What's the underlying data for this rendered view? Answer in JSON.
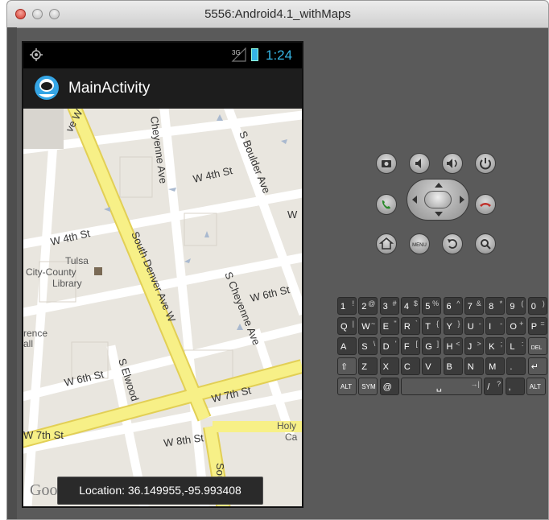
{
  "window": {
    "title": "5556:Android4.1_withMaps"
  },
  "statusbar": {
    "signal": "3G",
    "time": "1:24"
  },
  "actionbar": {
    "title": "MainActivity"
  },
  "map": {
    "streets": {
      "main_vertical": "South Denver Ave W",
      "w4th_top": "W 4th St",
      "w4th_left": "W 4th St",
      "cheyenne_top": "Cheyenne Ave",
      "s_boulder": "S Boulder Ave",
      "s_cheyenne_mid": "S Cheyenne Ave",
      "w6th_right": "W 6th St",
      "w6th_left": "W 6th St",
      "s_elwood": "S Elwood",
      "w7th_right": "W 7th St",
      "w7th_left": "W 7th St",
      "w8th": "W 8th St",
      "south_d": "South D",
      "denver_top": "ve W",
      "w_edge": "W"
    },
    "poi": {
      "library_line1": "Tulsa",
      "library_line2": "City-County",
      "library_line3": "Library",
      "left_poi1": "rence",
      "left_poi2": "all",
      "holy1": "Holy",
      "holy2": "Ca"
    },
    "attribution": "Google"
  },
  "toast": {
    "text": "Location: 36.149955,-95.993408"
  },
  "controls": {
    "row1": [
      "camera-icon",
      "volume-down-icon",
      "volume-up-icon",
      "power-icon"
    ],
    "row2": [
      "call-icon",
      "dpad",
      "end-call-icon"
    ],
    "row3": [
      "home-icon",
      "menu-icon",
      "back-icon",
      "search-icon"
    ],
    "menu_label": "MENU"
  },
  "keyboard": {
    "row1": [
      {
        "k": "1",
        "s": "!"
      },
      {
        "k": "2",
        "s": "@"
      },
      {
        "k": "3",
        "s": "#"
      },
      {
        "k": "4",
        "s": "$"
      },
      {
        "k": "5",
        "s": "%"
      },
      {
        "k": "6",
        "s": "^"
      },
      {
        "k": "7",
        "s": "&"
      },
      {
        "k": "8",
        "s": "*"
      },
      {
        "k": "9",
        "s": "("
      },
      {
        "k": "0",
        "s": ")"
      }
    ],
    "row2": [
      {
        "k": "Q",
        "s": "|"
      },
      {
        "k": "W",
        "s": "~"
      },
      {
        "k": "E",
        "s": "\""
      },
      {
        "k": "R",
        "s": "`"
      },
      {
        "k": "T",
        "s": "{"
      },
      {
        "k": "Y",
        "s": "}"
      },
      {
        "k": "U",
        "s": "-"
      },
      {
        "k": "I",
        "s": "-"
      },
      {
        "k": "O",
        "s": "+"
      },
      {
        "k": "P",
        "s": "="
      }
    ],
    "row3": [
      {
        "k": "A",
        "s": ""
      },
      {
        "k": "S",
        "s": "\\"
      },
      {
        "k": "D",
        "s": "'"
      },
      {
        "k": "F",
        "s": "["
      },
      {
        "k": "G",
        "s": "]"
      },
      {
        "k": "H",
        "s": "<"
      },
      {
        "k": "J",
        "s": ">"
      },
      {
        "k": "K",
        "s": ";"
      },
      {
        "k": "L",
        "s": ":"
      },
      {
        "k": "DEL",
        "s": ""
      }
    ],
    "row4": [
      {
        "k": "⇧",
        "s": ""
      },
      {
        "k": "Z",
        "s": ""
      },
      {
        "k": "X",
        "s": ""
      },
      {
        "k": "C",
        "s": ""
      },
      {
        "k": "V",
        "s": ""
      },
      {
        "k": "B",
        "s": ""
      },
      {
        "k": "N",
        "s": ""
      },
      {
        "k": "M",
        "s": ""
      },
      {
        "k": ".",
        "s": ""
      },
      {
        "k": "↵",
        "s": ""
      }
    ],
    "row5": [
      {
        "k": "ALT",
        "s": ""
      },
      {
        "k": "SYM",
        "s": ""
      },
      {
        "k": "@",
        "s": ""
      },
      {
        "k": "␣",
        "s": "→|"
      },
      {
        "k": "/",
        "s": "?"
      },
      {
        "k": ",",
        "s": ""
      },
      {
        "k": "ALT",
        "s": ""
      }
    ]
  },
  "colors": {
    "major_road": "#f7f087",
    "minor_road": "#ffffff",
    "block": "#e4e0d8",
    "status_accent": "#35b5e5"
  }
}
